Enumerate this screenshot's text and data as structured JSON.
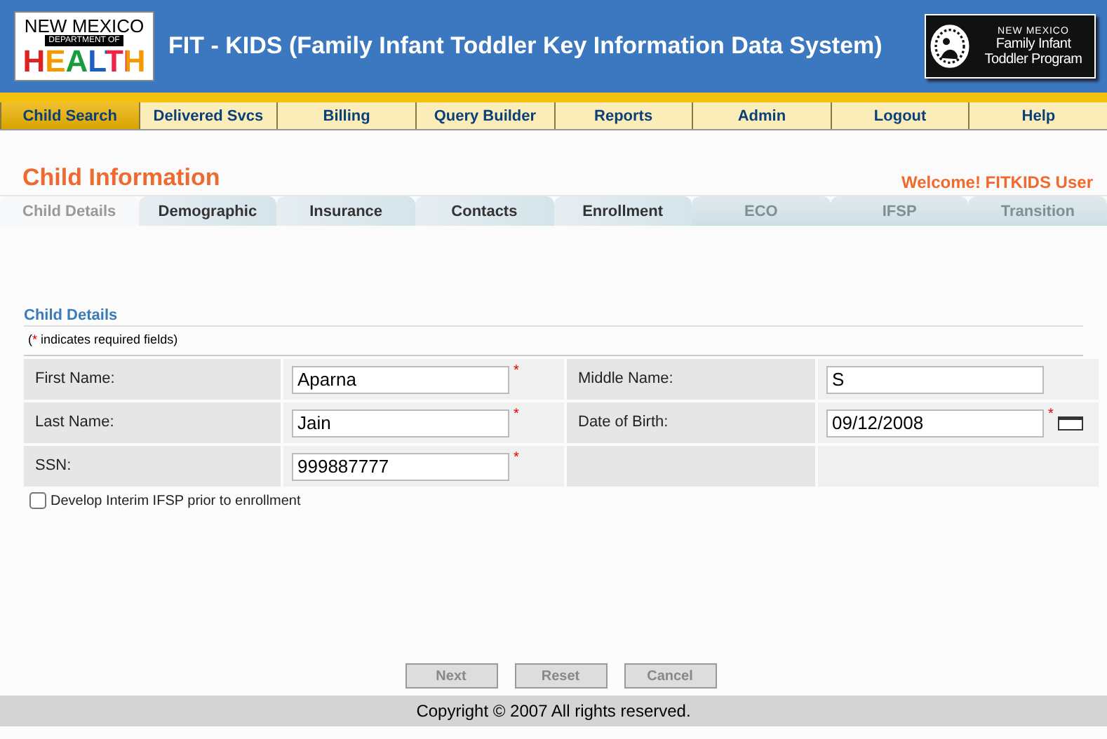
{
  "header": {
    "left_logo": {
      "line_1": "NEW MEXICO",
      "line_2": "DEPARTMENT OF",
      "line_3": "HEALTH"
    },
    "title": "FIT - KIDS (Family Infant Toddler Key Information Data System)",
    "right_logo": {
      "line_1": "NEW MEXICO",
      "line_2": "Family Infant",
      "line_3": "Toddler Program"
    }
  },
  "nav": [
    {
      "label": "Child Search",
      "selected": true
    },
    {
      "label": "Delivered Svcs",
      "selected": false
    },
    {
      "label": "Billing",
      "selected": false
    },
    {
      "label": "Query Builder",
      "selected": false
    },
    {
      "label": "Reports",
      "selected": false
    },
    {
      "label": "Admin",
      "selected": false
    },
    {
      "label": "Logout",
      "selected": false
    },
    {
      "label": "Help",
      "selected": false
    }
  ],
  "page_title": "Child Information",
  "welcome": "Welcome! FITKIDS User",
  "tabs": [
    {
      "label": "Child Details",
      "selected": true,
      "disabled": false
    },
    {
      "label": "Demographic",
      "selected": false,
      "disabled": false
    },
    {
      "label": "Insurance",
      "selected": false,
      "disabled": false
    },
    {
      "label": "Contacts",
      "selected": false,
      "disabled": false
    },
    {
      "label": "Enrollment",
      "selected": false,
      "disabled": false
    },
    {
      "label": "ECO",
      "selected": false,
      "disabled": true
    },
    {
      "label": "IFSP",
      "selected": false,
      "disabled": true
    },
    {
      "label": "Transition",
      "selected": false,
      "disabled": true
    }
  ],
  "section_title": "Child Details",
  "required_note": {
    "open": "(",
    "mark": "*",
    "text": " indicates required fields)"
  },
  "fields": [
    {
      "label": "First Name:",
      "value": "Aparna",
      "required": true,
      "calendar": false
    },
    {
      "label": "Middle Name:",
      "value": "S",
      "required": false,
      "calendar": false
    },
    {
      "label": "Last Name:",
      "value": "Jain",
      "required": true,
      "calendar": false
    },
    {
      "label": "Date of Birth:",
      "value": "09/12/2008",
      "required": true,
      "calendar": true
    },
    {
      "label": "SSN:",
      "value": "999887777",
      "required": true,
      "calendar": false
    }
  ],
  "required_mark": "*",
  "interim_checkbox": {
    "label": "Develop Interim IFSP prior to enrollment",
    "checked": false
  },
  "buttons": [
    {
      "label": "Next",
      "disabled": true
    },
    {
      "label": "Reset",
      "disabled": true
    },
    {
      "label": "Cancel",
      "disabled": true
    }
  ],
  "footer": "Copyright © 2007 All rights reserved."
}
